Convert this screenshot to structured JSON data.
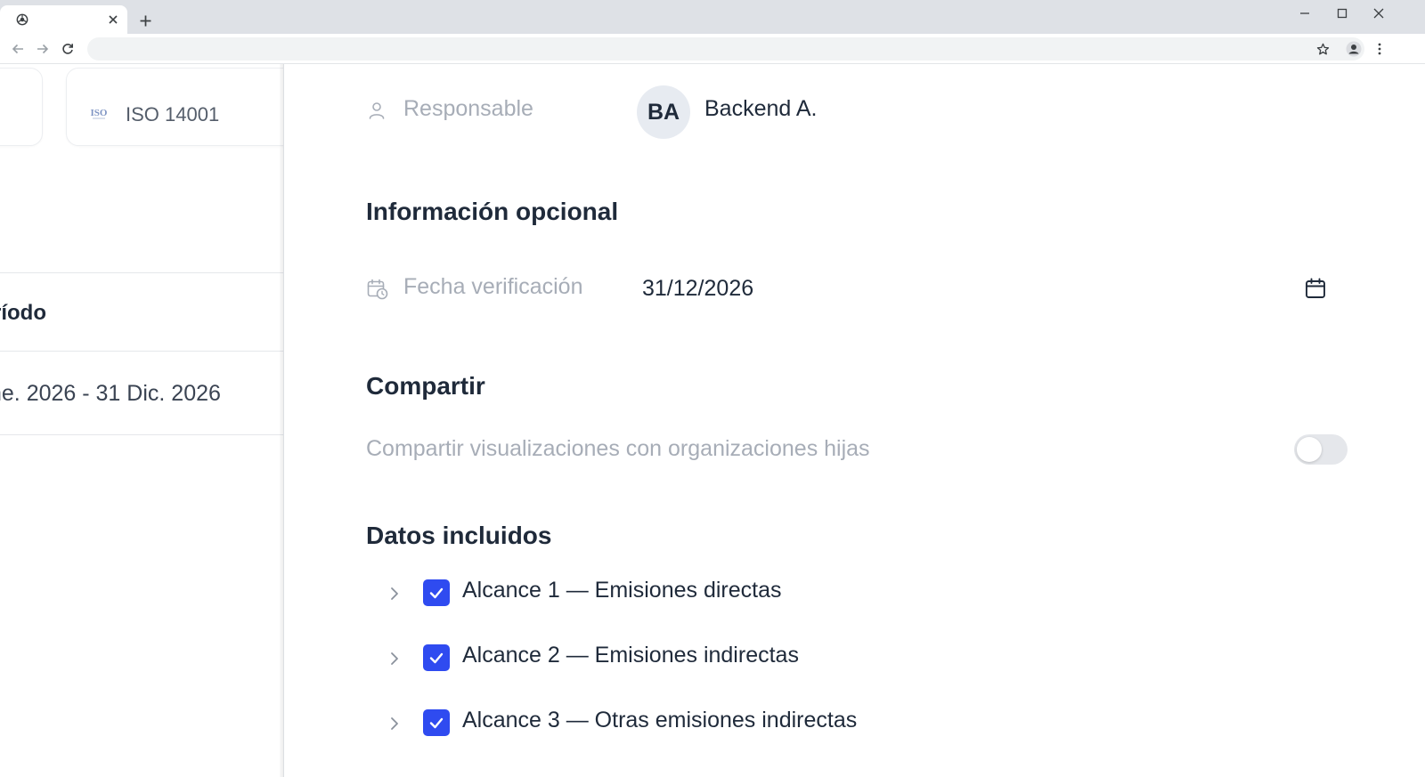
{
  "left_panel": {
    "iso_chip_label": "ISO 14001",
    "iso_icon_text": "ISO",
    "periodo_label": "ríodo",
    "period_range": "ne. 2026 - 31 Dic. 2026"
  },
  "drawer": {
    "responsable": {
      "label": "Responsable",
      "avatar_initials": "BA",
      "name": "Backend A."
    },
    "optional_info": {
      "title": "Información opcional",
      "date_label": "Fecha verificación",
      "date_value": "31/12/2026"
    },
    "share": {
      "title": "Compartir",
      "toggle_label": "Compartir visualizaciones con organizaciones hijas",
      "enabled": false
    },
    "included_data": {
      "title": "Datos incluidos",
      "items": [
        {
          "label": "Alcance 1 — Emisiones directas",
          "checked": true
        },
        {
          "label": "Alcance 2 — Emisiones indirectas",
          "checked": true
        },
        {
          "label": "Alcance 3 — Otras emisiones indirectas",
          "checked": true
        }
      ]
    }
  },
  "colors": {
    "accent": "#2f4bf0",
    "muted_text": "#a7adb7",
    "primary_text": "#1f2a3a",
    "avatar_bg": "#e7ebf1"
  }
}
